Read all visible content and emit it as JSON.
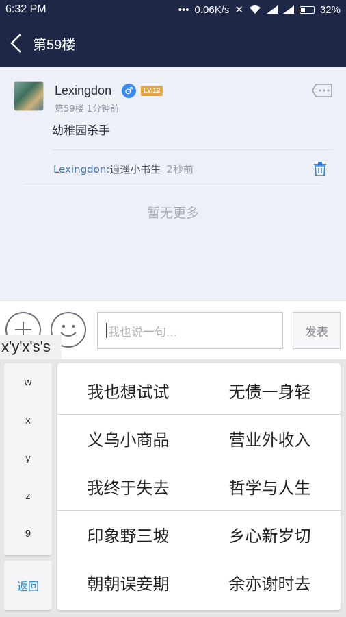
{
  "status_bar": {
    "time": "6:32 PM",
    "network_speed": "0.06K/s",
    "battery": "32%"
  },
  "nav": {
    "title": "第59楼"
  },
  "post": {
    "username": "Lexingdon",
    "level": "LV.12",
    "meta": "第59楼  1分钟前",
    "text": "幼稚园杀手",
    "reply": {
      "author": "Lexingdon:",
      "body": "逍遥小书生",
      "time": "2秒前"
    },
    "no_more": "暂无更多"
  },
  "input": {
    "placeholder": "我也说一句...",
    "send_label": "发表"
  },
  "ime": {
    "pinyin": "x'y'x's's",
    "letters": [
      "w",
      "x",
      "y",
      "z",
      "9"
    ],
    "return_label": "返回",
    "candidates": [
      "我也想试试",
      "无债一身轻",
      "义乌小商品",
      "营业外收入",
      "我终于失去",
      "哲学与人生",
      "印象野三坡",
      "乡心新岁切",
      "朝朝误妾期",
      "余亦谢时去"
    ]
  },
  "colors": {
    "header_bg": "#1f2847",
    "accent_blue": "#3a6fb0",
    "level_badge": "#f0a23a"
  }
}
